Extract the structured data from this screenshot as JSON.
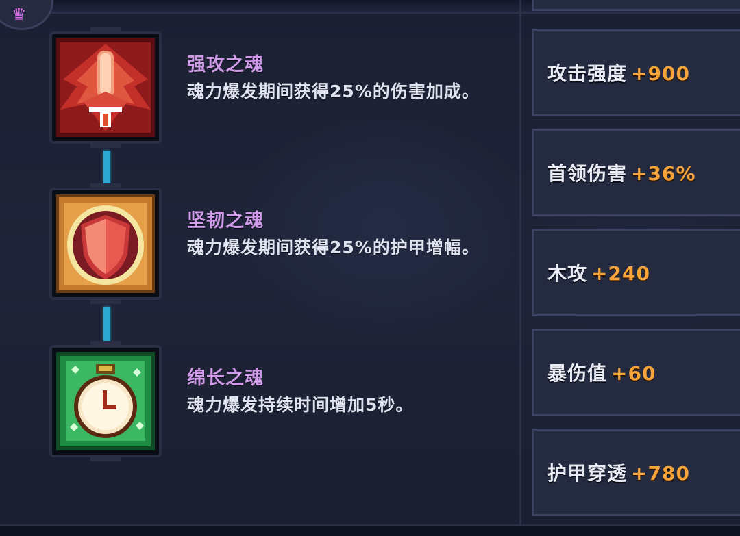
{
  "skills": [
    {
      "name": "强攻之魂",
      "description": "魂力爆发期间获得25%的伤害加成。",
      "icon": "red-rocket-icon"
    },
    {
      "name": "坚韧之魂",
      "description": "魂力爆发期间获得25%的护甲增幅。",
      "icon": "shield-icon"
    },
    {
      "name": "绵长之魂",
      "description": "魂力爆发持续时间增加5秒。",
      "icon": "stopwatch-icon"
    }
  ],
  "stats": [
    {
      "label": "攻击强度",
      "value": "+900"
    },
    {
      "label": "首领伤害",
      "value": "+36%"
    },
    {
      "label": "木攻",
      "value": "+240"
    },
    {
      "label": "暴伤值",
      "value": "+60"
    },
    {
      "label": "护甲穿透",
      "value": "+780"
    }
  ],
  "colors": {
    "skill_name": "#cf9be8",
    "stat_value": "#f7a43a",
    "panel": "#242a40",
    "chain": "#2aa8d0"
  }
}
